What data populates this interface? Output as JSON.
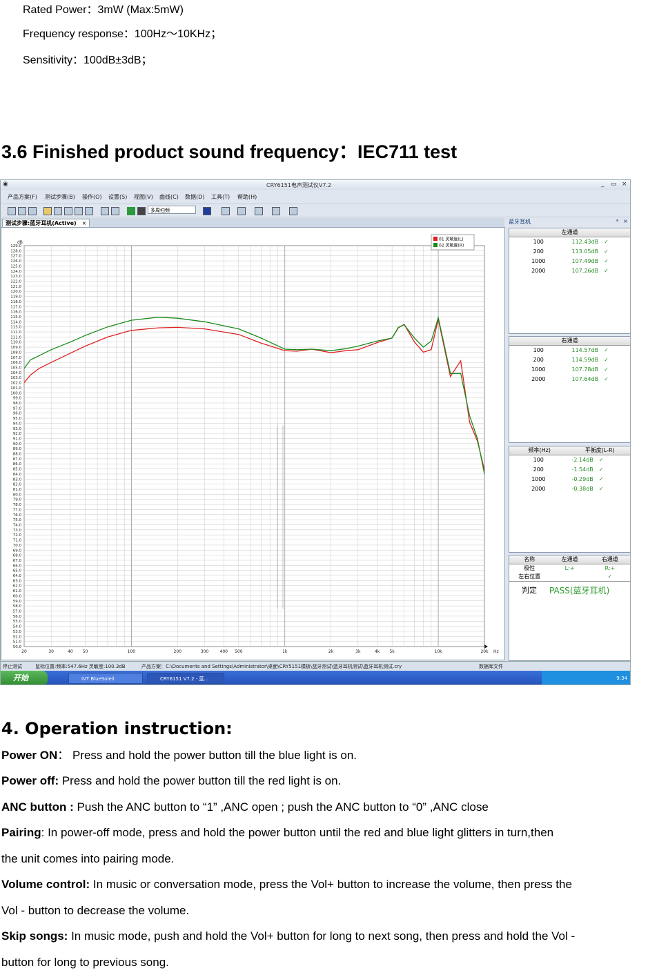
{
  "specs": [
    "Rated Power：3mW (Max:5mW)",
    "Frequency response：100Hz～10KHz；",
    "Sensitivity：100dB±3dB；"
  ],
  "section36_title": "3.6 Finished product sound frequency：IEC711 test",
  "screenshot": {
    "window_title": "CRY6151电声测试仪V7.2",
    "menu": [
      "产品方案(F)",
      "测试步骤(B)",
      "操作(O)",
      "设置(S)",
      "视图(V)",
      "曲线(C)",
      "数据(D)",
      "工具(T)",
      "帮助(H)"
    ],
    "dropdown_value": "多周扫频",
    "tab_label": "测试步骤:蓝牙耳机(Active)",
    "tab_close": "×",
    "right_panel_title": "蓝牙耳机",
    "left_channel": {
      "header": "左通道",
      "rows": [
        {
          "freq": "100",
          "val": "112.43dB"
        },
        {
          "freq": "200",
          "val": "113.05dB"
        },
        {
          "freq": "1000",
          "val": "107.49dB"
        },
        {
          "freq": "2000",
          "val": "107.26dB"
        }
      ]
    },
    "right_channel": {
      "header": "右通道",
      "rows": [
        {
          "freq": "100",
          "val": "114.57dB"
        },
        {
          "freq": "200",
          "val": "114.59dB"
        },
        {
          "freq": "1000",
          "val": "107.78dB"
        },
        {
          "freq": "2000",
          "val": "107.64dB"
        }
      ]
    },
    "balance": {
      "header_freq": "频率(Hz)",
      "header_val": "平衡度(L-R)",
      "rows": [
        {
          "freq": "100",
          "val": "-2.14dB"
        },
        {
          "freq": "200",
          "val": "-1.54dB"
        },
        {
          "freq": "1000",
          "val": "-0.29dB"
        },
        {
          "freq": "2000",
          "val": "-0.38dB"
        }
      ]
    },
    "polarity": {
      "headers": [
        "名称",
        "左通道",
        "右通道"
      ],
      "row1": [
        "极性",
        "L:+",
        "R:+"
      ],
      "row2": [
        "左右位置",
        "",
        "✓"
      ],
      "judge_label": "判定",
      "judge_result": "PASS(蓝牙耳机)"
    },
    "status": {
      "s1": "停止测试",
      "s2": "鼠标位置:频率:547.6Hz 灵敏度:100.3dB",
      "s3": "产品方案：C:\\Documents and Settings\\Administrator\\桌面\\CRY5151模板\\蓝牙测试\\蓝牙耳机测试\\蓝牙耳机测试.cry",
      "s4": "数据库文件"
    },
    "taskbar": {
      "start": "开始",
      "task1": "IVT BlueSoleil",
      "task2": "CRY6151 V7.2 - 蓝...",
      "clock": "9:34"
    }
  },
  "chart_data": {
    "type": "line",
    "ylabel": "dB",
    "xlabel": "Hz",
    "ylim": [
      50,
      129
    ],
    "xlim": [
      20,
      20000
    ],
    "xscale": "log",
    "x_ticks": [
      "20",
      "30",
      "40",
      "50",
      "100",
      "200",
      "300",
      "400",
      "500",
      "1k",
      "2k",
      "3k",
      "4k",
      "5k",
      "10k",
      "20k"
    ],
    "x_tick_values": [
      20,
      30,
      40,
      50,
      100,
      200,
      300,
      400,
      500,
      1000,
      2000,
      3000,
      4000,
      5000,
      10000,
      20000
    ],
    "legend": [
      "01 灵敏度(L)",
      "02 灵敏度(R)"
    ],
    "series": [
      {
        "name": "01 灵敏度(L)",
        "color": "#e02020",
        "x": [
          20,
          22,
          25,
          30,
          40,
          50,
          70,
          100,
          150,
          200,
          300,
          500,
          700,
          1000,
          1200,
          1500,
          2000,
          2500,
          3000,
          4000,
          5000,
          5500,
          6000,
          7000,
          8000,
          9000,
          10000,
          12000,
          14000,
          16000,
          18000,
          20000
        ],
        "y": [
          102.0,
          103.5,
          104.8,
          106.0,
          107.8,
          109.2,
          111.0,
          112.3,
          112.8,
          112.9,
          112.6,
          111.5,
          109.8,
          108.3,
          108.2,
          108.6,
          107.9,
          108.3,
          108.5,
          109.9,
          110.8,
          112.8,
          113.5,
          110.0,
          108.0,
          108.5,
          114.5,
          103.2,
          106.3,
          94.2,
          90.5,
          84.8
        ]
      },
      {
        "name": "02 灵敏度(R)",
        "color": "#1a8a1a",
        "x": [
          20,
          22,
          25,
          30,
          40,
          50,
          70,
          100,
          150,
          200,
          300,
          500,
          700,
          1000,
          1200,
          1500,
          2000,
          2500,
          3000,
          4000,
          5000,
          5500,
          6000,
          7000,
          8000,
          9000,
          10000,
          12000,
          14000,
          16000,
          18000,
          20000
        ],
        "y": [
          104.8,
          106.5,
          107.3,
          108.5,
          110.0,
          111.3,
          113.0,
          114.3,
          114.9,
          114.7,
          114.0,
          112.6,
          110.8,
          108.6,
          108.5,
          108.6,
          108.3,
          108.7,
          109.2,
          110.2,
          110.8,
          112.9,
          113.4,
          110.8,
          109.0,
          110.2,
          114.8,
          103.8,
          103.8,
          95.5,
          91.0,
          84.0
        ]
      }
    ]
  },
  "section4": {
    "title": "4. Operation instruction:",
    "lines": [
      {
        "label": "Power ON",
        "text": "：  Press and hold the power button till the blue light is on."
      },
      {
        "label": "Power off:",
        "text": " Press and hold the power button till the red light is on."
      },
      {
        "label": "ANC button :",
        "text": " Push the ANC button to “1” ,ANC open ; push the ANC button to “0” ,ANC close"
      },
      {
        "label": "Pairing",
        "text": ": In power-off mode, press and hold the power button until the red and blue light glitters in turn,then"
      },
      {
        "label": "",
        "text": "the unit comes into pairing mode."
      },
      {
        "label": "Volume control:",
        "text": " In music or conversation mode, press the Vol+ button to increase the volume, then press the"
      },
      {
        "label": "",
        "text": "Vol - button to decrease the volume."
      },
      {
        "label": "Skip songs:",
        "text": " In music mode, push and hold the Vol+ button for long to next song, then press and hold the Vol -"
      },
      {
        "label": "",
        "text": "button for long to previous song."
      }
    ]
  }
}
